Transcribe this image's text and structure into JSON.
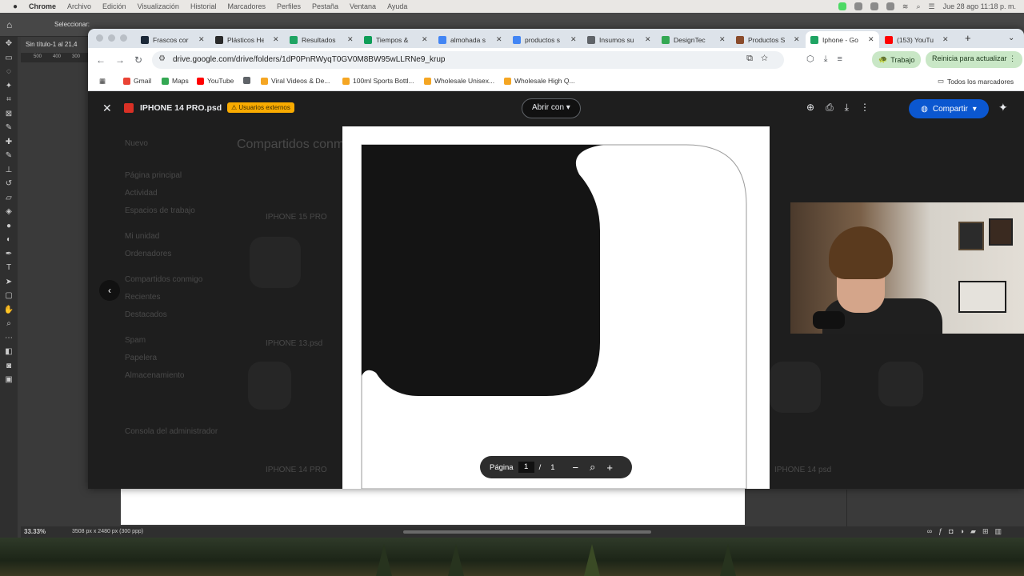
{
  "menubar": {
    "app": "Chrome",
    "items": [
      "Archivo",
      "Edición",
      "Visualización",
      "Historial",
      "Marcadores",
      "Perfiles",
      "Pestaña",
      "Ventana",
      "Ayuda"
    ],
    "clock": "Jue 28 ago  11:18 p. m."
  },
  "photoshop": {
    "options_label": "Seleccionar:",
    "doc_tab": "Sin título-1 al 21,4",
    "ruler_marks": [
      "500",
      "400",
      "300"
    ],
    "zoom": "33.33%",
    "doc_info": "3508 px x 2480 px (300 ppp)"
  },
  "browser": {
    "tabs": [
      {
        "label": "Frascos cor",
        "icon_color": "#1b2838"
      },
      {
        "label": "Plásticos He",
        "icon_color": "#2a2a2a"
      },
      {
        "label": "Resultados",
        "icon_color": "#1fa463"
      },
      {
        "label": "Tiempos & ",
        "icon_color": "#0f9d58"
      },
      {
        "label": "almohada s",
        "icon_color": "#4285f4"
      },
      {
        "label": "productos s",
        "icon_color": "#4285f4"
      },
      {
        "label": "Insumos su",
        "icon_color": "#5f6368"
      },
      {
        "label": "DesignTec",
        "icon_color": "#34a853"
      },
      {
        "label": "Productos S",
        "icon_color": "#8a4b2b"
      },
      {
        "label": "Iphone - Go",
        "icon_color": "#1fa463",
        "active": true
      },
      {
        "label": "(153) YouTu",
        "icon_color": "#ff0000"
      }
    ],
    "url": "drive.google.com/drive/folders/1dP0PnRWyqT0GV0M8BW95wLLRNe9_krup",
    "profile_chip": "Trabajo",
    "update_chip": "Reinicia para actualizar",
    "bookmarks": [
      {
        "label": "Gmail",
        "icon_color": "#ea4335"
      },
      {
        "label": "Maps",
        "icon_color": "#34a853"
      },
      {
        "label": "YouTube",
        "icon_color": "#ff0000"
      },
      {
        "label": "",
        "icon_color": "#5f6368"
      },
      {
        "label": "Viral Videos & De...",
        "icon_color": "#f5a623"
      },
      {
        "label": "100ml Sports Bottl...",
        "icon_color": "#f5a623"
      },
      {
        "label": "Wholesale Unisex...",
        "icon_color": "#f5a623"
      },
      {
        "label": "Wholesale High Q...",
        "icon_color": "#f5a623"
      }
    ],
    "all_bookmarks": "Todos los marcadores"
  },
  "viewer": {
    "file_name": "IPHONE 14 PRO.psd",
    "badge": "Usuarios externos",
    "open_with": "Abrir con",
    "share": "Compartir",
    "page_label": "Página",
    "page_current": "1",
    "page_sep": "/",
    "page_total": "1"
  },
  "drive_bg": {
    "new": "Nuevo",
    "heading": "Compartidos conmigo",
    "nav": [
      "Página principal",
      "Actividad",
      "Espacios de trabajo",
      "Mi unidad",
      "Ordenadores",
      "Compartidos conmigo",
      "Recientes",
      "Destacados",
      "Spam",
      "Papelera",
      "Almacenamiento"
    ],
    "admin": "Consola del administrador",
    "files": [
      "IPHONE 15 PRO",
      "IPHONE 13.psd",
      "IPHONE 14 psd",
      "IPHONE 14 PRO"
    ]
  }
}
